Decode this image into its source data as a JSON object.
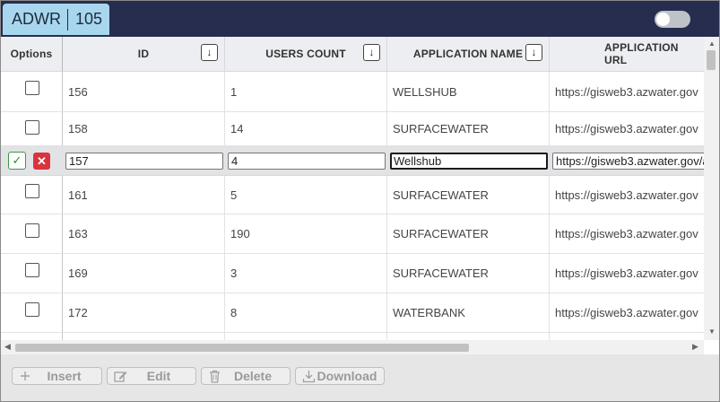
{
  "header": {
    "app": "ADWR",
    "count": "105"
  },
  "columns": {
    "options": "Options",
    "id": "ID",
    "users_count": "USERS COUNT",
    "application_name": "APPLICATION NAME",
    "application_url": "APPLICATION URL",
    "sort_glyph": "↓"
  },
  "rows": [
    {
      "id": "156",
      "users_count": "1",
      "application_name": "WELLSHUB",
      "application_url": "https://gisweb3.azwater.gov"
    },
    {
      "id": "158",
      "users_count": "14",
      "application_name": "SURFACEWATER",
      "application_url": "https://gisweb3.azwater.gov"
    },
    {
      "id": "161",
      "users_count": "5",
      "application_name": "SURFACEWATER",
      "application_url": "https://gisweb3.azwater.gov"
    },
    {
      "id": "163",
      "users_count": "190",
      "application_name": "SURFACEWATER",
      "application_url": "https://gisweb3.azwater.gov"
    },
    {
      "id": "169",
      "users_count": "3",
      "application_name": "SURFACEWATER",
      "application_url": "https://gisweb3.azwater.gov"
    },
    {
      "id": "172",
      "users_count": "8",
      "application_name": "WATERBANK",
      "application_url": "https://gisweb3.azwater.gov"
    }
  ],
  "edit_row": {
    "id": "157",
    "users_count": "4",
    "application_name": "Wellshub",
    "application_url": "https://gisweb3.azwater.gov/a",
    "confirm_glyph": "✓",
    "cancel_glyph": "✕"
  },
  "toolbar": {
    "insert": "Insert",
    "edit": "Edit",
    "delete": "Delete",
    "download": "Download"
  },
  "icons": {
    "insert": "plus-icon",
    "edit": "edit-icon",
    "delete": "trash-icon",
    "download": "download-icon"
  },
  "colors": {
    "topbar": "#262d4f",
    "title_tab": "#a8d6ee",
    "confirm": "#2e8b3a",
    "cancel": "#d9343e"
  }
}
